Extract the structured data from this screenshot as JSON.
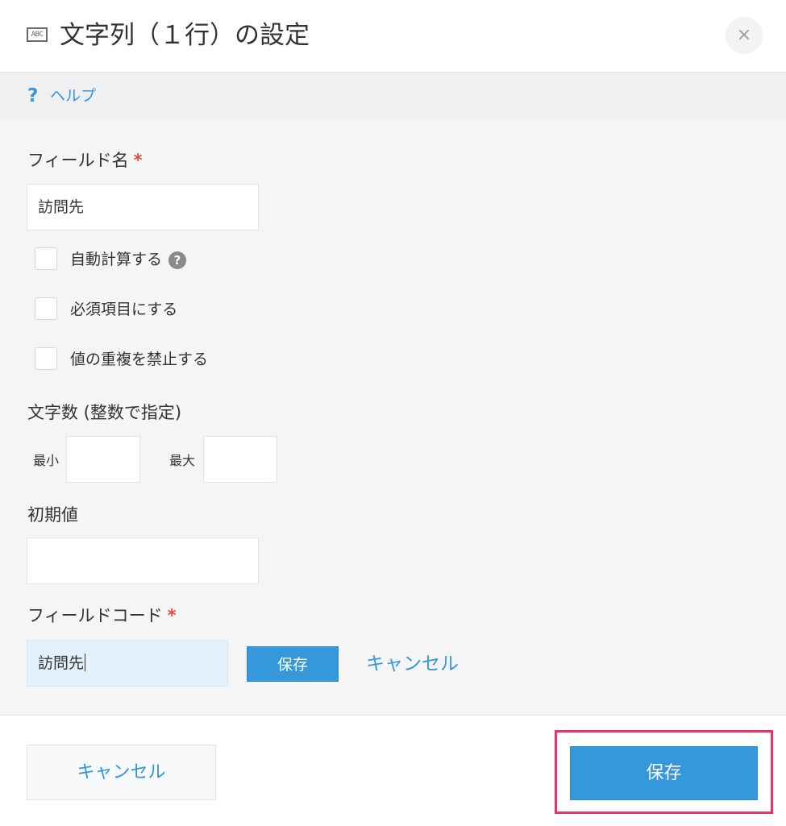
{
  "header": {
    "icon_text": "ABC",
    "title": "文字列（１行）の設定",
    "close_glyph": "×"
  },
  "help": {
    "icon_glyph": "?",
    "link_label": "ヘルプ"
  },
  "form": {
    "field_name": {
      "label": "フィールド名",
      "required_mark": "*",
      "value": "訪問先"
    },
    "checkboxes": [
      {
        "label": "自動計算する",
        "checked": false,
        "has_help": true,
        "help_glyph": "?"
      },
      {
        "label": "必須項目にする",
        "checked": false
      },
      {
        "label": "値の重複を禁止する",
        "checked": false
      }
    ],
    "char_count": {
      "label": "文字数 (整数で指定)",
      "min_label": "最小",
      "min_value": "",
      "max_label": "最大",
      "max_value": ""
    },
    "default_value": {
      "label": "初期値",
      "value": ""
    },
    "field_code": {
      "label": "フィールドコード",
      "required_mark": "*",
      "value": "訪問先",
      "save_label": "保存",
      "cancel_label": "キャンセル"
    }
  },
  "footer": {
    "cancel_label": "キャンセル",
    "save_label": "保存"
  },
  "colors": {
    "accent": "#3498db",
    "required": "#e74c3c",
    "highlight": "#e8336d",
    "focused_input": "#e2f1fc"
  }
}
